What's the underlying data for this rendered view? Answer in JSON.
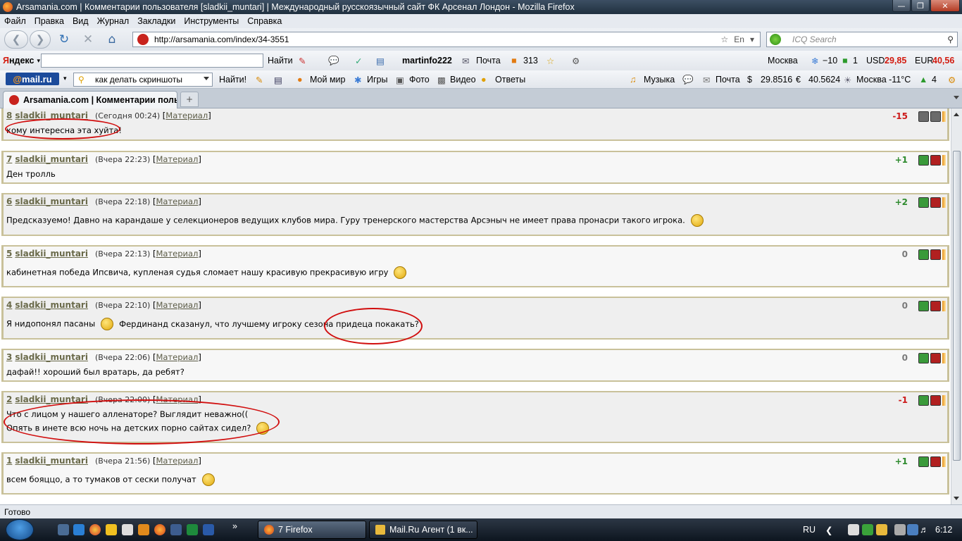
{
  "window": {
    "title": "Arsamania.com | Комментарии пользователя [sladkii_muntari] | Международный русскоязычный сайт ФК Арсенал Лондон - Mozilla Firefox"
  },
  "menu": [
    "Файл",
    "Правка",
    "Вид",
    "Журнал",
    "Закладки",
    "Инструменты",
    "Справка"
  ],
  "nav": {
    "url": "http://arsamania.com/index/34-3551",
    "lang_badge": "En",
    "search_placeholder": "ICQ Search"
  },
  "yandex": {
    "logo_first": "Я",
    "logo_rest": "ндекс",
    "find_label": "Найти",
    "user": "martinfo222",
    "mail_label": "Почта",
    "count": "313",
    "city": "Москва",
    "temp": "−10",
    "traffic": "1",
    "usd_label": "USD",
    "usd_value": "29,85",
    "eur_label": "EUR",
    "eur_value": "40,56"
  },
  "mailru": {
    "logo_at": "@",
    "logo_text": "mail.ru",
    "search_value": "как делать скриншоты",
    "find_label": "Найти!",
    "links": [
      "Мой мир",
      "Игры",
      "Фото",
      "Видео",
      "Ответы"
    ],
    "music": "Музыка",
    "mail": "Почта",
    "usd": "29.8516",
    "eur": "40.5624",
    "weather": "Москва -11°C",
    "count": "4"
  },
  "tabs": {
    "active_label": "Arsamania.com | Комментарии поль..."
  },
  "comments": [
    {
      "num": "8",
      "user": "sladkii_muntari",
      "date": "(Сегодня 00:24)",
      "link": "Материал",
      "lines": [
        "кому интересна эта хуйта!"
      ],
      "rating": "-15",
      "smiles": false
    },
    {
      "num": "7",
      "user": "sladkii_muntari",
      "date": "(Вчера 22:23)",
      "link": "Материал",
      "lines": [
        "Ден тролль"
      ],
      "rating": "+1",
      "smiles": false
    },
    {
      "num": "6",
      "user": "sladkii_muntari",
      "date": "(Вчера 22:18)",
      "link": "Материал",
      "lines": [
        "Предсказуемо! Давно на карандаше у селекционеров ведущих клубов мира. Гуру тренерского мастерства Арсэныч не имеет права пронасри такого игрока."
      ],
      "rating": "+2",
      "smiles": true
    },
    {
      "num": "5",
      "user": "sladkii_muntari",
      "date": "(Вчера 22:13)",
      "link": "Материал",
      "lines": [
        "кабинетная победа Ипсвича, купленая судья сломает нашу красивую прекрасивую игру"
      ],
      "rating": "0",
      "smiles": true
    },
    {
      "num": "4",
      "user": "sladkii_muntari",
      "date": "(Вчера 22:10)",
      "link": "Материал",
      "lines": [
        "Я нидопонял пасаны",
        "Фердинанд сказанул, что лучшему игроку сезона придеца покакать?"
      ],
      "rating": "0",
      "smiles": true
    },
    {
      "num": "3",
      "user": "sladkii_muntari",
      "date": "(Вчера 22:06)",
      "link": "Материал",
      "lines": [
        "дафай!! хороший был вратарь, да ребят?"
      ],
      "rating": "0",
      "smiles": false
    },
    {
      "num": "2",
      "user": "sladkii_muntari",
      "date": "(Вчера 22:00)",
      "link": "Материал",
      "lines": [
        "Что с лицом у нашего алленаторе? Выглядит неважно((",
        "Опять в инете всю ночь на детских порно сайтах сидел?"
      ],
      "rating": "-1",
      "smiles": true
    },
    {
      "num": "1",
      "user": "sladkii_muntari",
      "date": "(Вчера 21:56)",
      "link": "Материал",
      "lines": [
        "всем бояццо, а то тумаков от сески получат"
      ],
      "rating": "+1",
      "smiles": true
    }
  ],
  "status": "Готово",
  "taskbar": {
    "firefox_btn": "7 Firefox",
    "agent_btn": "Mail.Ru Агент (1 вк...",
    "lang": "RU",
    "clock": "6:12"
  },
  "colors": {
    "rating_positive": "#2e8b2e",
    "rating_negative": "#cc1b1b",
    "rating_zero": "#7a7a7a",
    "highlight": "#d10e0e"
  }
}
